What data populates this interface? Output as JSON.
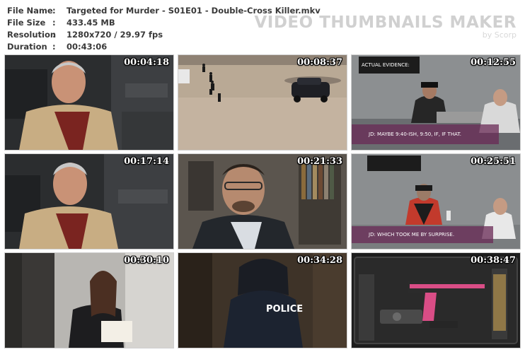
{
  "file_info": {
    "rows": [
      {
        "key": "File Name",
        "sep": ":",
        "value": "Targeted for Murder - S01E01 - Double-Cross Killer.mkv"
      },
      {
        "key": "File Size",
        "sep": ":",
        "value": "433.45 MB"
      },
      {
        "key": "Resolution",
        "sep": ":",
        "value": "1280x720 / 29.97 fps"
      },
      {
        "key": "Duration",
        "sep": ":",
        "value": "00:43:06"
      }
    ]
  },
  "brand": {
    "title": "VIDEO THUMBNAILS MAKER",
    "subtitle": "by Scorp"
  },
  "thumbnails": [
    {
      "timestamp": "00:04:18"
    },
    {
      "timestamp": "00:08:37"
    },
    {
      "timestamp": "00:12:55",
      "caption_top": "ACTUAL EVIDENCE:",
      "caption_bottom": "JD: MAYBE 9:40-ISH, 9:50, IF, IF THAT."
    },
    {
      "timestamp": "00:17:14"
    },
    {
      "timestamp": "00:21:33"
    },
    {
      "timestamp": "00:25:51",
      "caption_bottom": "JD: WHICH TOOK ME BY SURPRISE."
    },
    {
      "timestamp": "00:30:10"
    },
    {
      "timestamp": "00:34:28",
      "badge": "POLICE"
    },
    {
      "timestamp": "00:38:47"
    }
  ]
}
